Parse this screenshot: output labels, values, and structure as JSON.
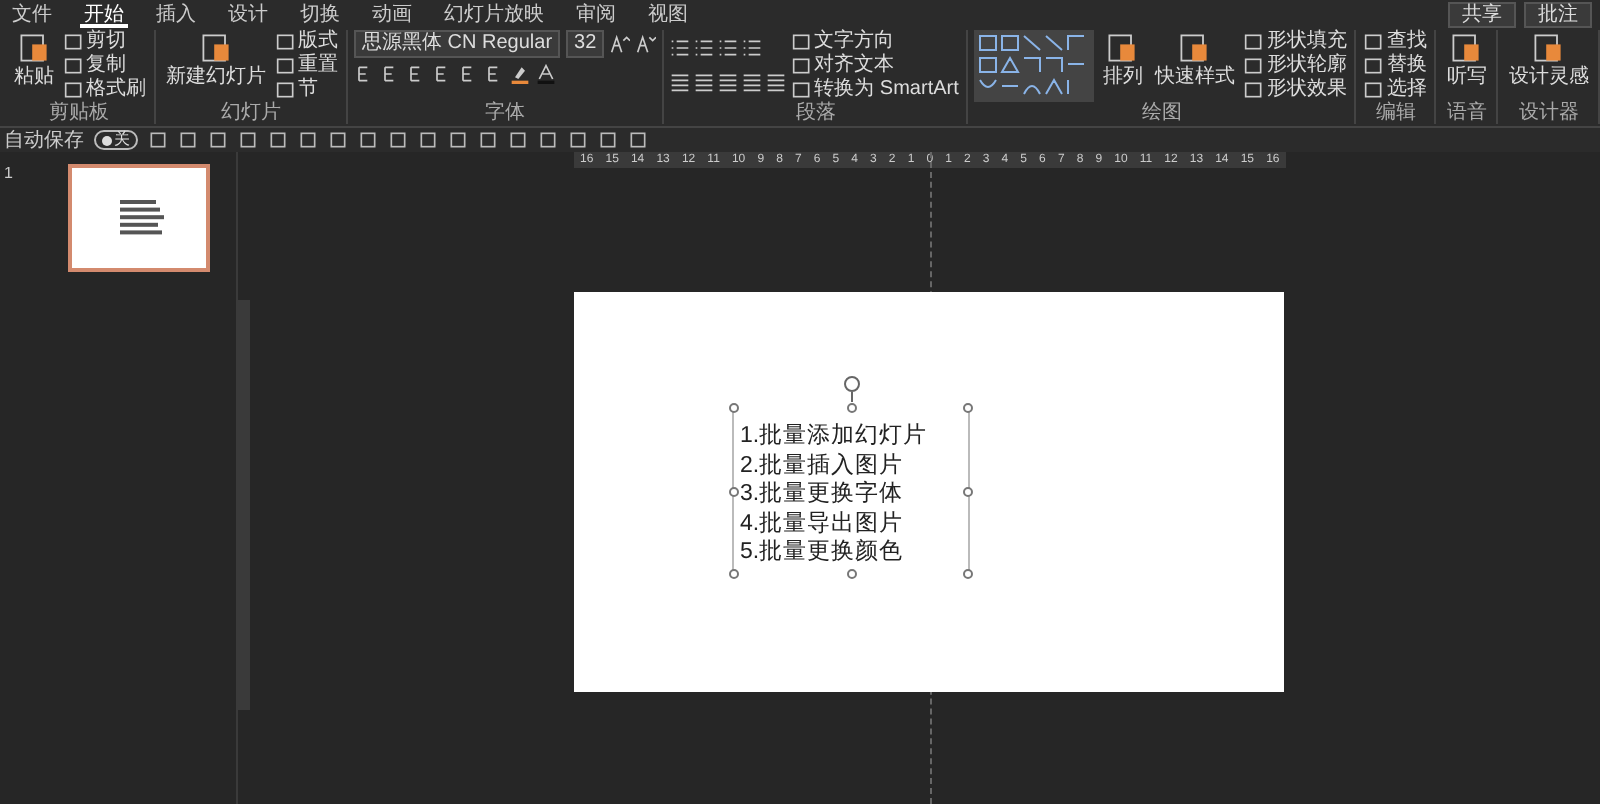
{
  "tabs": [
    {
      "label": "文件",
      "selected": false
    },
    {
      "label": "开始",
      "selected": true
    },
    {
      "label": "插入",
      "selected": false
    },
    {
      "label": "设计",
      "selected": false
    },
    {
      "label": "切换",
      "selected": false
    },
    {
      "label": "动画",
      "selected": false
    },
    {
      "label": "幻灯片放映",
      "selected": false
    },
    {
      "label": "审阅",
      "selected": false
    },
    {
      "label": "视图",
      "selected": false
    }
  ],
  "header_buttons": [
    "共享",
    "批注"
  ],
  "ribbon": {
    "groups": [
      {
        "kind": "clipboard",
        "label": "剪贴板",
        "large": [
          "粘贴"
        ],
        "items": [
          {
            "kind": "small",
            "label": "剪切"
          },
          {
            "kind": "small",
            "label": "复制"
          },
          {
            "kind": "small",
            "label": "格式刷"
          }
        ]
      },
      {
        "kind": "slides",
        "label": "幻灯片",
        "large": [
          "新建幻灯片"
        ],
        "items": [
          {
            "kind": "small",
            "label": "版式"
          },
          {
            "kind": "small",
            "label": "重置"
          },
          {
            "kind": "small",
            "label": "节"
          }
        ]
      },
      {
        "kind": "font",
        "label": "字体",
        "font": "思源黑体 CN Regular",
        "size": "32"
      },
      {
        "kind": "paragraph",
        "label": "段落",
        "items": [
          {
            "kind": "small",
            "label": "文字方向"
          },
          {
            "kind": "small",
            "label": "对齐文本"
          },
          {
            "kind": "small",
            "label": "转换为 SmartArt"
          }
        ]
      },
      {
        "kind": "drawing",
        "label": "绘图",
        "large": [
          "排列",
          "快速样式"
        ],
        "items": [
          {
            "kind": "small",
            "label": "形状填充"
          },
          {
            "kind": "small",
            "label": "形状轮廓"
          },
          {
            "kind": "small",
            "label": "形状效果"
          }
        ]
      },
      {
        "kind": "editing",
        "label": "编辑",
        "items": [
          {
            "kind": "small",
            "label": "查找"
          },
          {
            "kind": "small",
            "label": "替换"
          },
          {
            "kind": "small",
            "label": "选择"
          }
        ]
      },
      {
        "kind": "voice",
        "label": "语音",
        "large": [
          "听写"
        ]
      },
      {
        "kind": "designer",
        "label": "设计器",
        "large": [
          "设计灵感"
        ]
      }
    ]
  },
  "autosave": {
    "label": "自动保存",
    "on": false,
    "state": "关"
  },
  "ruler_numbers": [
    "16",
    "15",
    "14",
    "13",
    "12",
    "11",
    "10",
    "9",
    "8",
    "7",
    "6",
    "5",
    "4",
    "3",
    "2",
    "1",
    "0",
    "1",
    "2",
    "3",
    "4",
    "5",
    "6",
    "7",
    "8",
    "9",
    "10",
    "11",
    "12",
    "13",
    "14",
    "15",
    "16"
  ],
  "thumbnails": [
    {
      "number": "1",
      "selected": true
    }
  ],
  "slide": {
    "list": [
      "1.批量添加幻灯片",
      "2.批量插入图片",
      "3.批量更换字体",
      "4.批量导出图片",
      "5.批量更换颜色"
    ]
  }
}
